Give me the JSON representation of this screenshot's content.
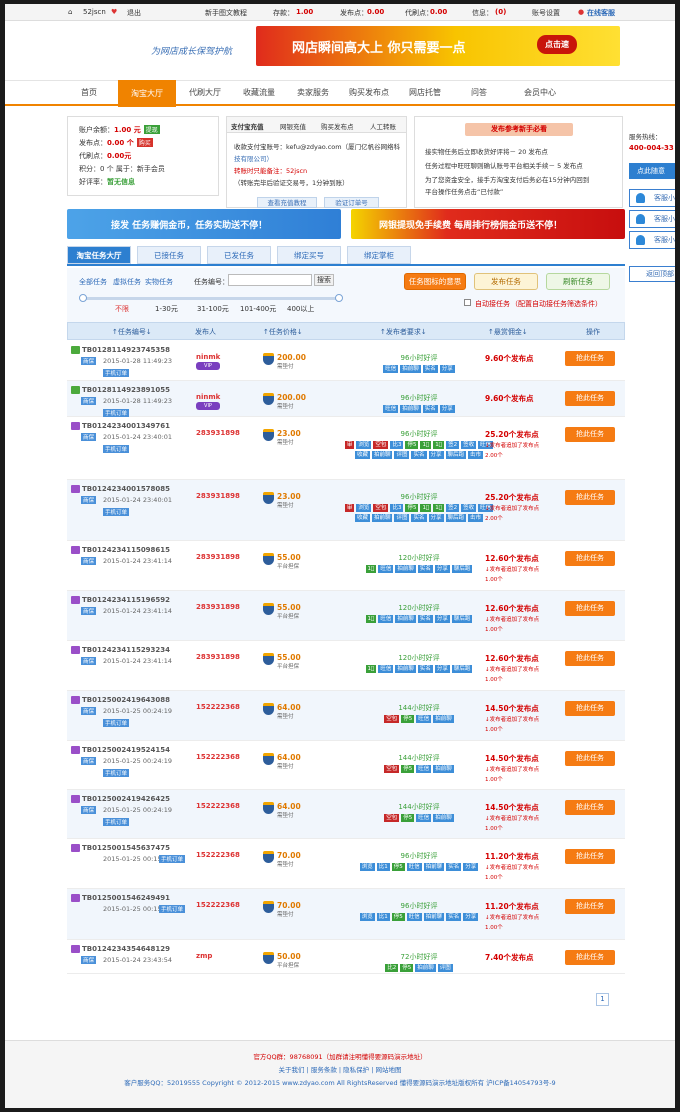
{
  "topbar": {
    "user": "52jscn",
    "logout": "退出",
    "guide": "新手图文教程",
    "deposit_label": "存款：",
    "deposit": "1.00",
    "points_label": "发布点：",
    "points": "0.00",
    "credit_label": "代刷点：",
    "credit": "0.00",
    "msg_label": "信息：",
    "msg": "(0)",
    "settings": "账号设置",
    "online_service": "在线客服"
  },
  "banner": {
    "slogan": "为网店成长保驾护航",
    "ad_text": "网店瞬间高大上 你只需要一点",
    "ad_btn": "点击速"
  },
  "nav": [
    "首页",
    "淘宝大厅",
    "代刷大厅",
    "收藏流量",
    "卖家服务",
    "购买发布点",
    "网店托管",
    "问答",
    "会员中心"
  ],
  "account": {
    "balance_label": "账户余额：",
    "balance": "1.00 元",
    "withdraw": "提现",
    "points_label": "发布点：",
    "points": "0.00 个",
    "recharge": "购买",
    "credit_label": "代刷点：",
    "credit": "0.00元",
    "score_label": "积分：",
    "score": "0 个 属于：新手会员",
    "rating_label": "好评率：",
    "rating": "暂无信息"
  },
  "pay": {
    "tabs": [
      "支付宝充值",
      "网银充值",
      "购买发布点",
      "人工转账"
    ],
    "line1": "收款支付宝账号：kefu@zdyao.com（厦门亿帆谷网络科",
    "line2": "技有限公司）",
    "line3": "转账时只能备注：52jscn",
    "line4": "（转账完毕后验证交易号，1分钟到账）",
    "btn1": "查看充值教程",
    "btn2": "验证订单号"
  },
  "notice": {
    "title": "发布参考新手必看",
    "items": [
      "接实物任务后立即收货好评将－ 20 发布点",
      "任务过程中旺旺聊则确认账号平台相关手续－ 5 发布点",
      "为了您资金安全，接手方淘宝支付后务必在15分钟内回到",
      "平台操作任务点击“已付款”"
    ]
  },
  "side": {
    "hotline_label": "服务热线：",
    "hotline": "400-004-33",
    "btn": "点此随意",
    "cs": [
      "客服小",
      "客服小",
      "客服小"
    ],
    "back": "返回顶部"
  },
  "promo": {
    "left": "接发 任务赚佣金币，任务实助送不停！",
    "right": "网银提现免手续费 每周排行榜佣金币送不停！"
  },
  "tabs": [
    "淘宝任务大厅",
    "已接任务",
    "已发任务",
    "绑定买号",
    "绑定掌柜"
  ],
  "filter": {
    "types": [
      "全部任务",
      "虚拟任务",
      "实物任务"
    ],
    "search_label": "任务编号：",
    "search_placeholder": "",
    "search_btn": "搜索",
    "btn_meaning": "任务图标的意思",
    "btn_publish": "发布任务",
    "btn_refresh": "刷新任务",
    "ranges": [
      "不限",
      "1-30元",
      "31-100元",
      "101-400元",
      "400以上"
    ],
    "auto": "自动接任务",
    "auto_note": "（配置自动接任务筛选条件）"
  },
  "thead": [
    "↑任务编号↓",
    "发布人",
    "↑任务价格↓",
    "↑发布者要求↓",
    "↑悬赏佣金↓",
    "操作"
  ],
  "take_label": "抢此任务",
  "tasks": [
    {
      "id": "TB0128114923745358",
      "date": "2015-01-28 11:49:23",
      "tag": "商保",
      "tag2": "手机订单",
      "pub": "ninmk",
      "vip": "VIP",
      "price": "200.00",
      "ptype": "需垫付",
      "req": "96小时好评",
      "chips": [
        "旺信",
        "拍前聊",
        "实名",
        "分享"
      ],
      "reward": "9.60个发布点",
      "notes": []
    },
    {
      "id": "TB0128114923891055",
      "date": "2015-01-28 11:49:23",
      "tag": "商保",
      "tag2": "手机订单",
      "pub": "ninmk",
      "vip": "VIP",
      "price": "200.00",
      "ptype": "需垫付",
      "req": "96小时好评",
      "chips": [
        "旺信",
        "拍前聊",
        "实名",
        "分享"
      ],
      "reward": "9.60个发布点",
      "notes": []
    },
    {
      "id": "TB0124234001349761",
      "date": "2015-01-24 23:40:01",
      "tag": "商保",
      "tag2": "手机订单",
      "pub": "283931898",
      "price": "23.00",
      "ptype": "需垫付",
      "req": "96小时好评",
      "chips": [
        "审",
        "浏览",
        "空包",
        "比3",
        "停5",
        "1⃣",
        "1⃣",
        "签2",
        "签收",
        "旺信",
        "收藏",
        "拍前聊",
        "评图",
        "实名",
        "分享",
        "聊后跑",
        "击市"
      ],
      "reward": "25.20个发布点",
      "notes": [
        "↓发布者追加了发布点",
        "2.00个"
      ]
    },
    {
      "id": "TB0124234001578085",
      "date": "2015-01-24 23:40:01",
      "tag": "商保",
      "tag2": "手机订单",
      "pub": "283931898",
      "price": "23.00",
      "ptype": "需垫付",
      "req": "96小时好评",
      "chips": [
        "审",
        "浏览",
        "空包",
        "比3",
        "停5",
        "1⃣",
        "1⃣",
        "签2",
        "签收",
        "旺信",
        "收藏",
        "拍前聊",
        "评图",
        "实名",
        "分享",
        "聊后跑",
        "击市"
      ],
      "reward": "25.20个发布点",
      "notes": [
        "↓发布者追加了发布点",
        "2.00个"
      ]
    },
    {
      "id": "TB0124234115098615",
      "date": "2015-01-24 23:41:14",
      "tag": "商保",
      "tag2": "",
      "pub": "283931898",
      "price": "55.00",
      "ptype": "平台担保",
      "req": "120小时好评",
      "chips": [
        "1⃣",
        "旺信",
        "拍前聊",
        "实名",
        "分享",
        "聊后跑"
      ],
      "reward": "12.60个发布点",
      "notes": [
        "↓发布者追加了发布点",
        "1.00个"
      ]
    },
    {
      "id": "TB0124234115196592",
      "date": "2015-01-24 23:41:14",
      "tag": "商保",
      "tag2": "",
      "pub": "283931898",
      "price": "55.00",
      "ptype": "平台担保",
      "req": "120小时好评",
      "chips": [
        "1⃣",
        "旺信",
        "拍前聊",
        "实名",
        "分享",
        "聊后跑"
      ],
      "reward": "12.60个发布点",
      "notes": [
        "↓发布者追加了发布点",
        "1.00个"
      ]
    },
    {
      "id": "TB0124234115293234",
      "date": "2015-01-24 23:41:14",
      "tag": "商保",
      "tag2": "",
      "pub": "283931898",
      "price": "55.00",
      "ptype": "平台担保",
      "req": "120小时好评",
      "chips": [
        "1⃣",
        "旺信",
        "拍前聊",
        "实名",
        "分享",
        "聊后跑"
      ],
      "reward": "12.60个发布点",
      "notes": [
        "↓发布者追加了发布点",
        "1.00个"
      ]
    },
    {
      "id": "TB0125002419643088",
      "date": "2015-01-25 00:24:19",
      "tag": "商保",
      "tag2": "手机订单",
      "pub": "152222368",
      "price": "64.00",
      "ptype": "需垫付",
      "req": "144小时好评",
      "chips": [
        "空包",
        "停5",
        "旺信",
        "拍前聊"
      ],
      "reward": "14.50个发布点",
      "notes": [
        "↓发布者追加了发布点",
        "1.00个"
      ]
    },
    {
      "id": "TB0125002419524154",
      "date": "2015-01-25 00:24:19",
      "tag": "商保",
      "tag2": "手机订单",
      "pub": "152222368",
      "price": "64.00",
      "ptype": "需垫付",
      "req": "144小时好评",
      "chips": [
        "空包",
        "停5",
        "旺信",
        "拍前聊"
      ],
      "reward": "14.50个发布点",
      "notes": [
        "↓发布者追加了发布点",
        "1.00个"
      ]
    },
    {
      "id": "TB0125002419426425",
      "date": "2015-01-25 00:24:19",
      "tag": "商保",
      "tag2": "手机订单",
      "pub": "152222368",
      "price": "64.00",
      "ptype": "需垫付",
      "req": "144小时好评",
      "chips": [
        "空包",
        "停5",
        "旺信",
        "拍前聊"
      ],
      "reward": "14.50个发布点",
      "notes": [
        "↓发布者追加了发布点",
        "1.00个"
      ]
    },
    {
      "id": "TB0125001545637475",
      "date": "2015-01-25 00:15:45",
      "tag": "",
      "tag2": "手机订单",
      "pub": "152222368",
      "price": "70.00",
      "ptype": "需垫付",
      "req": "96小时好评",
      "chips": [
        "浏览",
        "比1",
        "停5",
        "旺信",
        "拍前聊",
        "实名",
        "分享"
      ],
      "reward": "11.20个发布点",
      "notes": [
        "↓发布者追加了发布点",
        "1.00个"
      ]
    },
    {
      "id": "TB0125001546249491",
      "date": "2015-01-25 00:15:45",
      "tag": "",
      "tag2": "手机订单",
      "pub": "152222368",
      "price": "70.00",
      "ptype": "需垫付",
      "req": "96小时好评",
      "chips": [
        "浏览",
        "比1",
        "停5",
        "旺信",
        "拍前聊",
        "实名",
        "分享"
      ],
      "reward": "11.20个发布点",
      "notes": [
        "↓发布者追加了发布点",
        "1.00个"
      ]
    },
    {
      "id": "TB0124234354648129",
      "date": "2015-01-24 23:43:54",
      "tag": "商保",
      "tag2": "",
      "pub": "zmp",
      "price": "50.00",
      "ptype": "平台担保",
      "req": "72小时好评",
      "chips": [
        "比2",
        "停5",
        "拍前聊",
        "评图"
      ],
      "reward": "7.40个发布点",
      "notes": []
    }
  ],
  "pager": "1",
  "footer": {
    "qq": "官方QQ群：98768091（加群请注明懂得要源码演示地址）",
    "links": "关于我们 | 服务条款 | 隐私保护 | 网站地图",
    "copy": "客户服务QQ：52019555 Copyright © 2012-2015 www.zdyao.com All RightsReserved 懂得要源码演示地址版权所有 沪ICP备14054793号-9"
  }
}
